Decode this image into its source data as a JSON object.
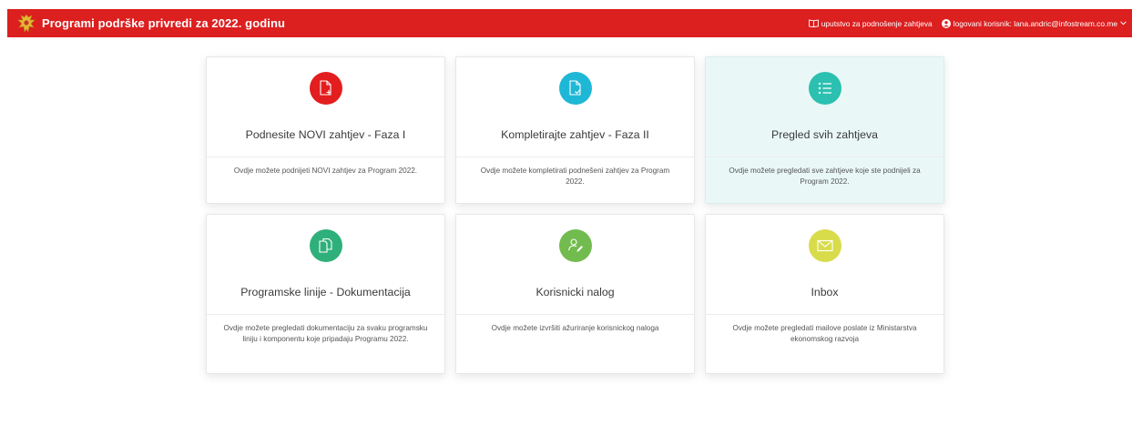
{
  "header": {
    "title": "Programi podrške privredi za 2022. godinu",
    "guide_link": "uputstvo za podnošenje zahtjeva",
    "user_link": "logovani korisnik: lana.andric@infostream.co.me",
    "bar_color": "#dc1f1f"
  },
  "cards": [
    {
      "title": "Podnesite NOVI zahtjev - Faza I",
      "description": "Ovdje možete podnijeti NOVI zahtjev za Program 2022.",
      "icon": "file-plus-icon",
      "color": "#e31e1e"
    },
    {
      "title": "Kompletirajte zahtjev - Faza II",
      "description": "Ovdje možete kompletirati podnešeni zahtjev za Program 2022.",
      "icon": "file-check-icon",
      "color": "#1fb7d6"
    },
    {
      "title": "Pregled svih zahtjeva",
      "description": "Ovdje možete pregledati sve zahtjeve koje ste podnijeli za Program 2022.",
      "icon": "list-icon",
      "color": "#2bc0b0"
    },
    {
      "title": "Programske linije - Dokumentacija",
      "description": "Ovdje možete pregledati dokumentaciju za svaku programsku liniju i komponentu koje pripadaju Programu 2022.",
      "icon": "documents-icon",
      "color": "#2fb07a"
    },
    {
      "title": "Korisnicki nalog",
      "description": "Ovdje možete izvršiti ažuriranje korisnickog naloga",
      "icon": "user-edit-icon",
      "color": "#72bb4f"
    },
    {
      "title": "Inbox",
      "description": "Ovdje možete pregledati mailove poslate iz Ministarstva ekonomskog razvoja",
      "icon": "envelope-icon",
      "color": "#d8dc4b"
    }
  ]
}
